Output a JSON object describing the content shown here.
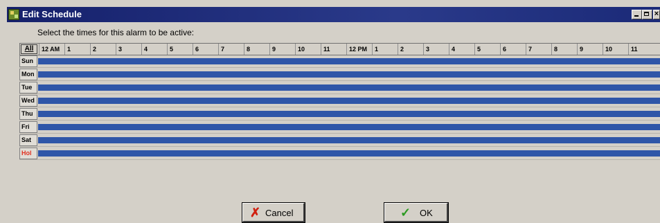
{
  "window": {
    "title": "Edit Schedule"
  },
  "instruction": "Select the times for this alarm to be active:",
  "grid": {
    "all_label": "All",
    "hours": [
      "12 AM",
      "1",
      "2",
      "3",
      "4",
      "5",
      "6",
      "7",
      "8",
      "9",
      "10",
      "11",
      "12 PM",
      "1",
      "2",
      "3",
      "4",
      "5",
      "6",
      "7",
      "8",
      "9",
      "10",
      "11"
    ],
    "days": [
      "Sun",
      "Mon",
      "Tue",
      "Wed",
      "Thu",
      "Fri",
      "Sat",
      "Hol"
    ],
    "active_fraction": 1.0,
    "active_color": "#2f56a8",
    "holiday_color": "#e03020"
  },
  "buttons": {
    "cancel": "Cancel",
    "ok": "OK"
  },
  "icons": {
    "cancel": "x-icon",
    "ok": "checkmark-icon"
  }
}
